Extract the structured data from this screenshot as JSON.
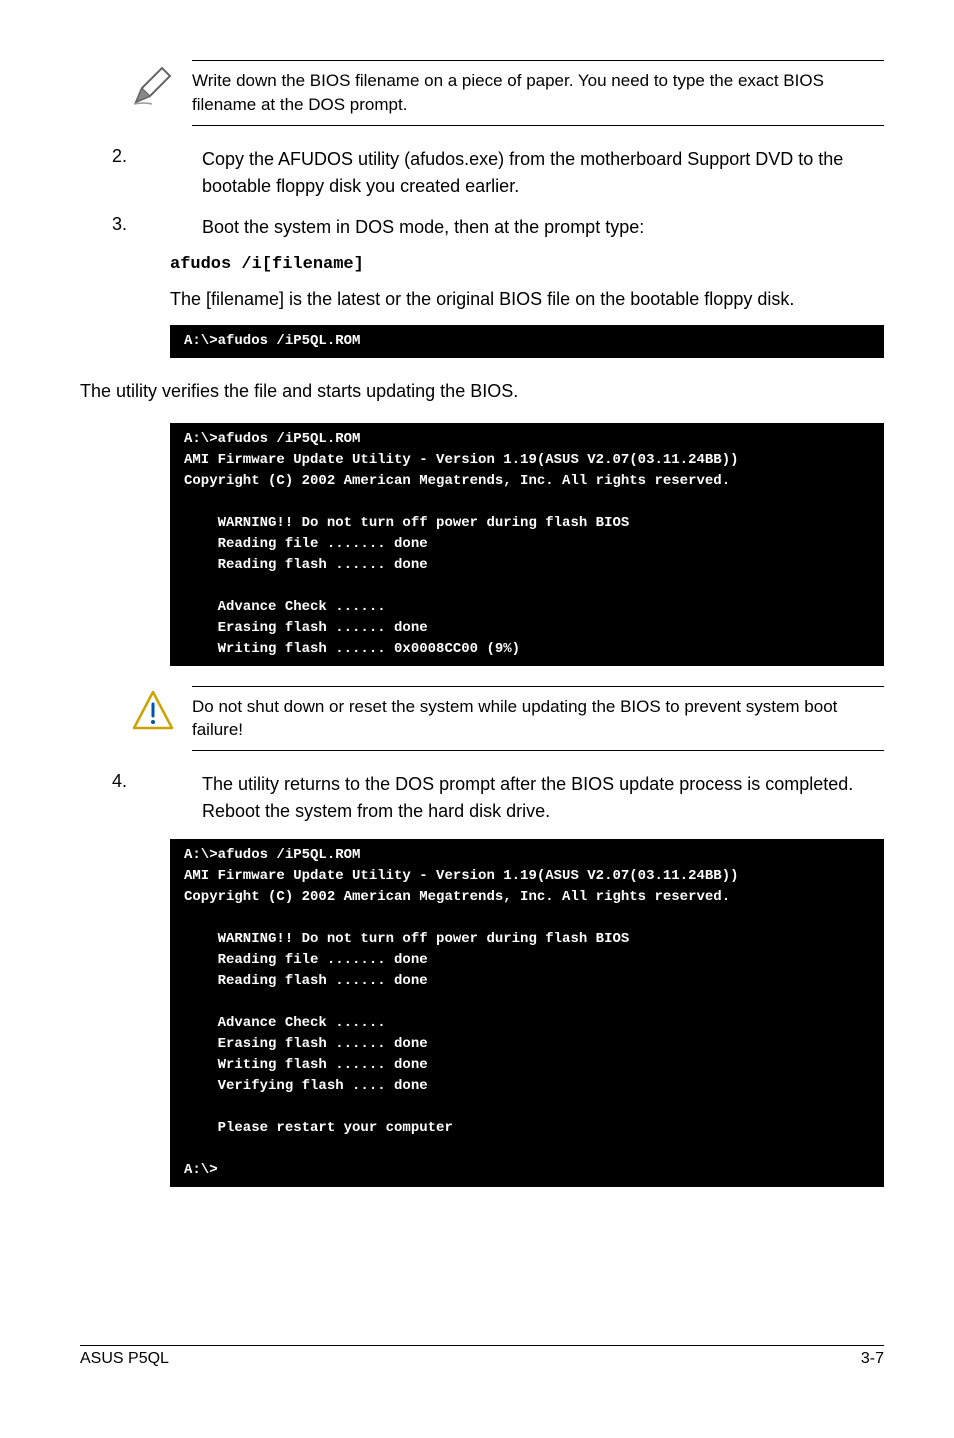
{
  "note1": "Write down the BIOS filename on a piece of paper. You need to type the exact BIOS filename at the DOS prompt.",
  "step2": {
    "num": "2.",
    "text": "Copy the AFUDOS utility (afudos.exe) from the motherboard Support DVD to the bootable floppy disk you created earlier."
  },
  "step3": {
    "num": "3.",
    "text": "Boot the system in DOS mode, then at the prompt type:"
  },
  "cmd": "afudos /i[filename]",
  "desc": "The [filename] is the latest or the original BIOS file on the bootable floppy disk.",
  "term1": "A:\\>afudos /iP5QL.ROM",
  "verifytext": "The utility verifies the file and starts updating the BIOS.",
  "term2": "A:\\>afudos /iP5QL.ROM\nAMI Firmware Update Utility - Version 1.19(ASUS V2.07(03.11.24BB))\nCopyright (C) 2002 American Megatrends, Inc. All rights reserved.\n\n    WARNING!! Do not turn off power during flash BIOS\n    Reading file ....... done\n    Reading flash ...... done\n\n    Advance Check ......\n    Erasing flash ...... done\n    Writing flash ...... 0x0008CC00 (9%)\n",
  "warning": "Do not shut down or reset the system while updating the BIOS to prevent system boot failure!",
  "step4": {
    "num": "4.",
    "text": "The utility returns to the DOS prompt after the BIOS update process is completed. Reboot the system from the hard disk drive."
  },
  "term3": "A:\\>afudos /iP5QL.ROM\nAMI Firmware Update Utility - Version 1.19(ASUS V2.07(03.11.24BB))\nCopyright (C) 2002 American Megatrends, Inc. All rights reserved.\n\n    WARNING!! Do not turn off power during flash BIOS\n    Reading file ....... done\n    Reading flash ...... done\n\n    Advance Check ......\n    Erasing flash ...... done\n    Writing flash ...... done\n    Verifying flash .... done\n\n    Please restart your computer\n\nA:\\>",
  "footer": {
    "left": "ASUS P5QL",
    "right": "3-7"
  }
}
